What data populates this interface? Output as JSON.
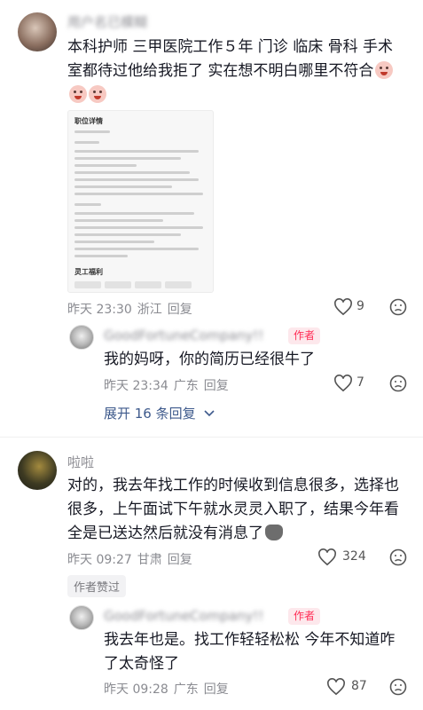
{
  "comments": [
    {
      "username": "用户名已模糊",
      "text": "本科护师 三甲医院工作５年 门诊 临床 骨科 手术室都待过他给我拒了 实在想不明白哪里不符合",
      "attachment": {
        "title": "职位详情",
        "section2": "灵工福利"
      },
      "time": "昨天 23:30",
      "location": "浙江",
      "reply_label": "回复",
      "likes": "9",
      "replies": [
        {
          "username": "GoodFortuneCompany!!",
          "badge": "作者",
          "text": "我的妈呀，你的简历已经很牛了",
          "time": "昨天 23:34",
          "location": "广东",
          "reply_label": "回复",
          "likes": "7"
        }
      ],
      "expand_label": "展开 16 条回复"
    },
    {
      "username": "啦啦",
      "text": "对的，我去年找工作的时候收到信息很多，选择也很多，上午面试下午就水灵灵入职了，结果今年看全是已送达然后就没有消息了",
      "time": "昨天 09:27",
      "location": "甘肃",
      "reply_label": "回复",
      "likes": "324",
      "author_liked": "作者赞过",
      "replies": [
        {
          "username": "GoodFortuneCompany!!",
          "badge": "作者",
          "text": "我去年也是。找工作轻轻松松 今年不知道咋了太奇怪了",
          "time": "昨天 09:28",
          "location": "广东",
          "reply_label": "回复",
          "likes": "87"
        }
      ]
    }
  ]
}
